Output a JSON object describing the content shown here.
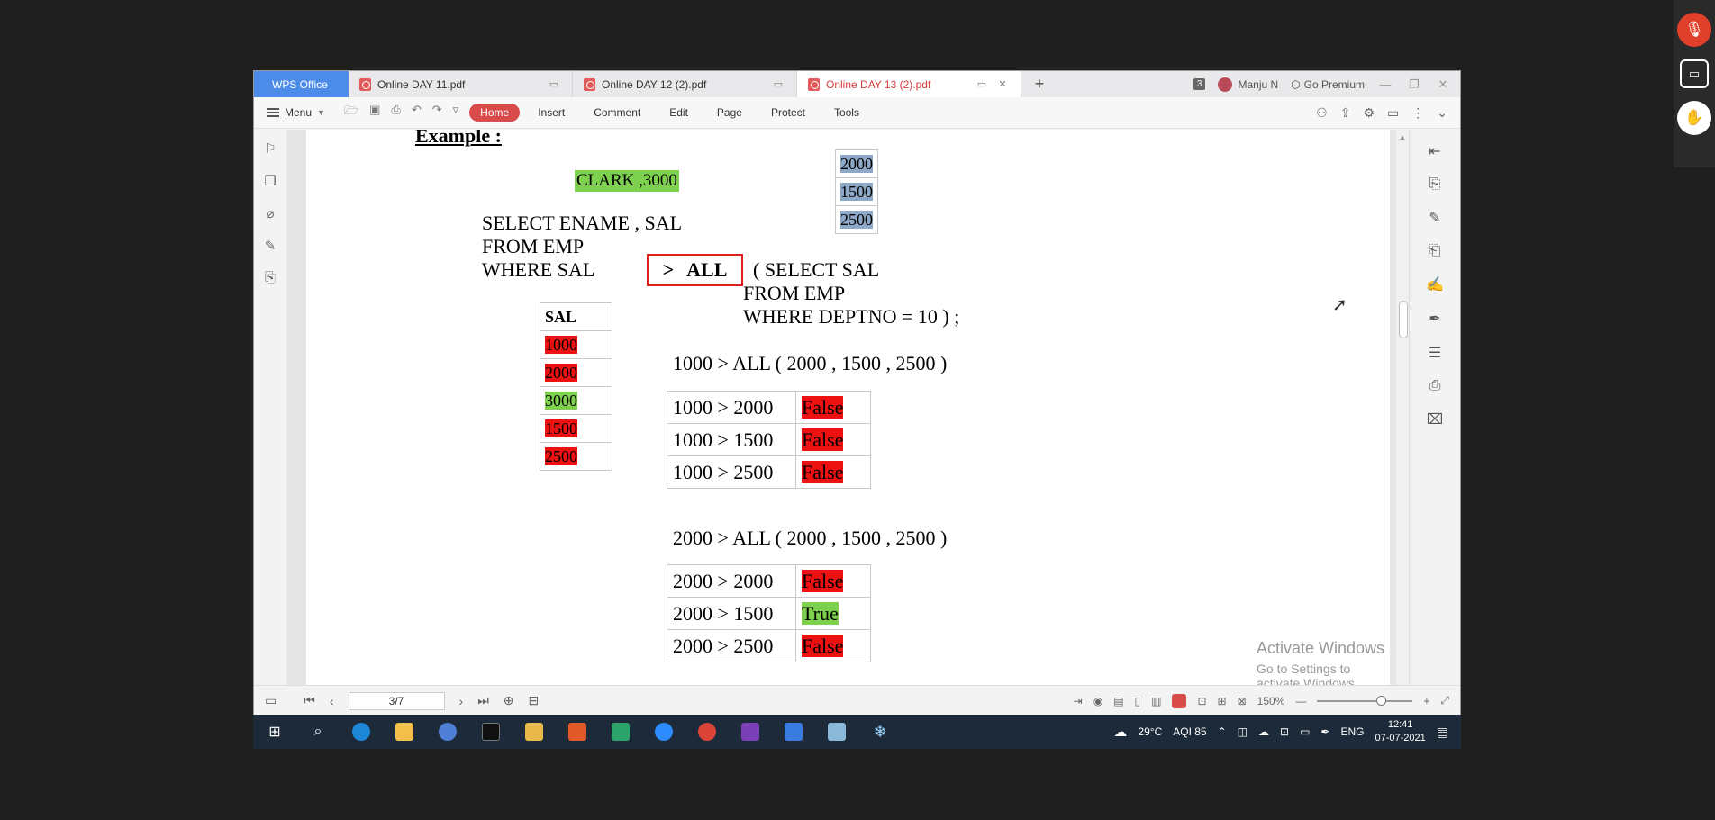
{
  "tabs": {
    "brand": "WPS Office",
    "docs": [
      {
        "title": "Online DAY 11.pdf",
        "active": false
      },
      {
        "title": "Online DAY 12 (2).pdf",
        "active": false
      },
      {
        "title": "Online DAY 13 (2).pdf",
        "active": true
      }
    ],
    "tab_count": "3",
    "user_name": "Manju N",
    "premium": "Go Premium"
  },
  "ribbon": {
    "menu_label": "Menu",
    "tabs": [
      "Home",
      "Insert",
      "Comment",
      "Edit",
      "Page",
      "Protect",
      "Tools"
    ],
    "active_tab": "Home"
  },
  "document": {
    "example_heading": "Example :",
    "highlight_result": "CLARK ,3000",
    "query_line1": "SELECT ENAME , SAL",
    "query_line2": "FROM EMP",
    "query_line3": "WHERE SAL",
    "operator": ">",
    "operator_keyword": "ALL",
    "subquery_line1": "( SELECT SAL",
    "subquery_line2": "FROM EMP",
    "subquery_line3": "WHERE DEPTNO = 10 ) ;",
    "subquery_values": [
      "2000",
      "1500",
      "2500"
    ],
    "sal_header": "SAL",
    "sal_values": [
      {
        "v": "1000",
        "status": "red"
      },
      {
        "v": "2000",
        "status": "red"
      },
      {
        "v": "3000",
        "status": "green"
      },
      {
        "v": "1500",
        "status": "red"
      },
      {
        "v": "2500",
        "status": "red"
      }
    ],
    "expr1": "1000 > ALL ( 2000 , 1500 , 2500 )",
    "table1": [
      {
        "cmp": "1000 > 2000",
        "res": "False"
      },
      {
        "cmp": "1000 > 1500",
        "res": "False"
      },
      {
        "cmp": "1000 > 2500",
        "res": "False"
      }
    ],
    "expr2": "2000 > ALL ( 2000 , 1500 , 2500 )",
    "table2": [
      {
        "cmp": "2000 > 2000",
        "res": "False"
      },
      {
        "cmp": "2000 > 1500",
        "res": "True"
      },
      {
        "cmp": "2000 > 2500",
        "res": "False"
      }
    ],
    "watermark_title": "Activate Windows",
    "watermark_sub": "Go to Settings to activate Windows."
  },
  "status": {
    "page_display": "3/7",
    "zoom": "150%"
  },
  "taskbar": {
    "weather": "29°C",
    "aqi": "AQI 85",
    "lang": "ENG",
    "time": "12:41",
    "date": "07-07-2021"
  },
  "colors": {
    "brand_blue": "#4d8be8",
    "accent_red": "#d94a4a",
    "true_green": "#7ed14e",
    "false_red": "#ee1111"
  }
}
